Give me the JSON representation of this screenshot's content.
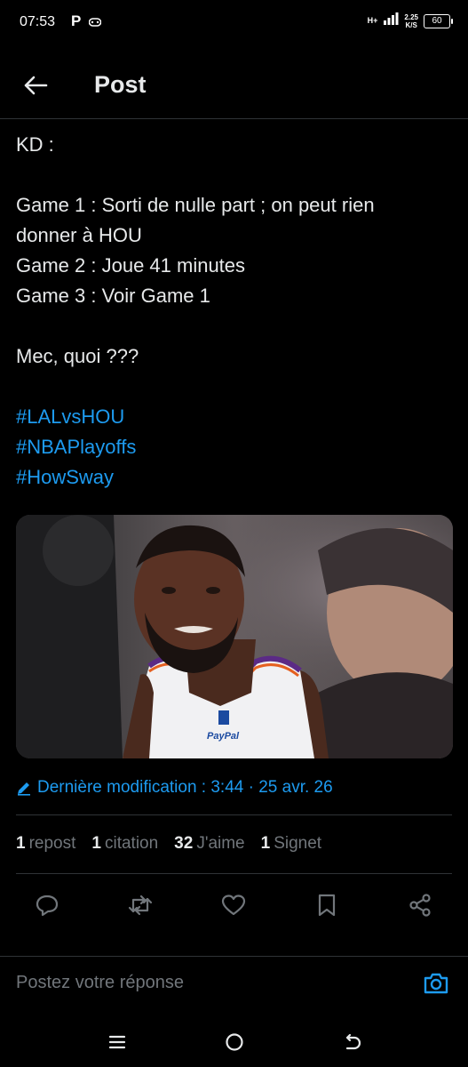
{
  "status_bar": {
    "time": "07:53",
    "p_label": "P",
    "network": "H+",
    "speed_value": "2.25",
    "speed_unit": "K/S",
    "battery": "60"
  },
  "header": {
    "title": "Post"
  },
  "post": {
    "lines": [
      "KD :",
      "",
      "Game 1 : Sorti de nulle part ; on peut rien",
      "donner à HOU",
      "Game 2 : Joue 41 minutes",
      "Game 3 : Voir Game 1",
      "",
      "Mec, quoi ???",
      ""
    ],
    "hashtags": [
      "#LALvsHOU",
      "#NBAPlayoffs",
      "#HowSway"
    ],
    "edited_label": "Dernière modification : 3:44 · 25 avr. 26"
  },
  "stats": {
    "reposts_count": "1",
    "reposts_label": "repost",
    "quotes_count": "1",
    "quotes_label": "citation",
    "likes_count": "32",
    "likes_label": "J'aime",
    "bookmarks_count": "1",
    "bookmarks_label": "Signet"
  },
  "actions": {
    "icons": [
      "reply-icon",
      "repost-icon",
      "like-icon",
      "bookmark-icon",
      "share-icon"
    ]
  },
  "reply": {
    "placeholder": "Postez votre réponse"
  },
  "colors": {
    "background": "#000000",
    "text": "#e7e9ea",
    "muted": "#71767b",
    "accent": "#1d9bf0",
    "border": "#2f3336"
  }
}
